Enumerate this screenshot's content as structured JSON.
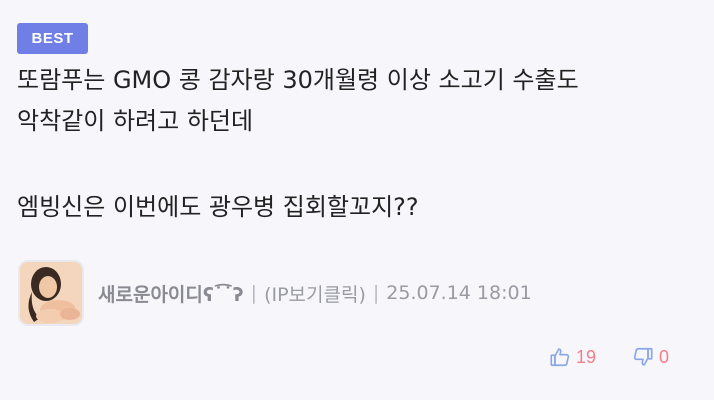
{
  "badge": {
    "label": "BEST"
  },
  "comment": {
    "lines": [
      "또람푸는 GMO 콩 감자랑 30개월령 이상 소고기 수출도",
      "악착같이 하려고 하던데",
      "엠빙신은 이번에도 광우병 집회할꼬지??"
    ]
  },
  "author": {
    "nickname": "새로운아이디ʕ˙͡˙ʔ",
    "ip_link": "(IP보기클릭)",
    "timestamp": "25.07.14 18:01",
    "separator": "|"
  },
  "votes": {
    "up_count": "19",
    "down_count": "0"
  },
  "colors": {
    "badge": "#6f7fe6",
    "thumb_icon": "#8aa6e8",
    "count": "#f07f89"
  },
  "icons": {
    "up": "thumbs-up-icon",
    "down": "thumbs-down-icon"
  }
}
